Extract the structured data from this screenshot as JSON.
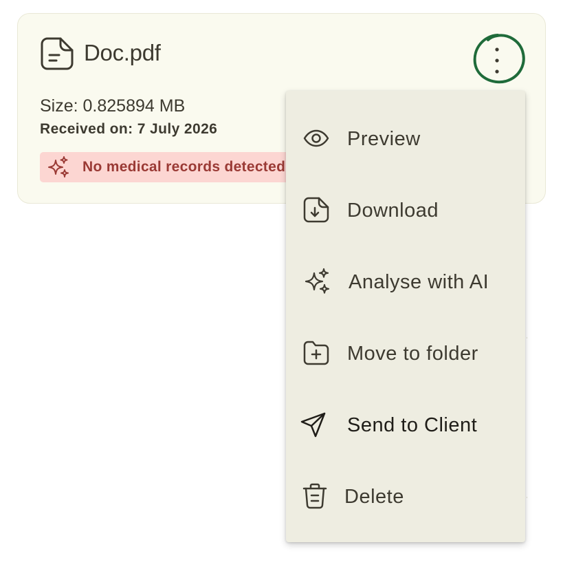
{
  "file": {
    "name": "Doc.pdf",
    "size": "Size: 0.825894 MB",
    "received": "Received on: 7 July 2026",
    "alert": "No medical records detected"
  },
  "menu": {
    "items": [
      {
        "label": "Preview",
        "icon": "eye-icon"
      },
      {
        "label": "Download",
        "icon": "download-file-icon"
      },
      {
        "label": "Analyse with AI",
        "icon": "sparkles-icon"
      },
      {
        "label": "Move to folder",
        "icon": "folder-plus-icon"
      },
      {
        "label": "Send to Client",
        "icon": "send-icon"
      },
      {
        "label": "Delete",
        "icon": "trash-icon"
      }
    ]
  },
  "colors": {
    "card_bg": "#fafaef",
    "menu_bg": "#eeede1",
    "alert_bg": "#fcd6d2",
    "alert_text": "#9a3a35",
    "highlight_circle": "#1f6b3a"
  }
}
